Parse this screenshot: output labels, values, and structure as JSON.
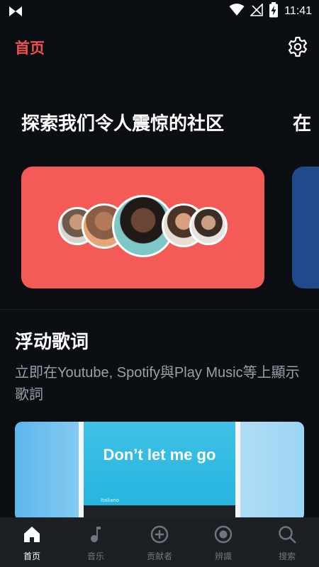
{
  "status_bar": {
    "time": "11:41",
    "icons": [
      "app-logo-icon",
      "wifi-icon",
      "no-signal-icon",
      "battery-charging-icon"
    ]
  },
  "header": {
    "title": "首页",
    "settings_icon": "gear-icon"
  },
  "carousel": {
    "cards": [
      {
        "title": "探索我们令人震惊的社区",
        "color": "#f45b57"
      },
      {
        "title": "在",
        "color": "#1f4a8c"
      }
    ]
  },
  "feature": {
    "title": "浮动歌词",
    "description": "立即在Youtube, Spotify與Play Music等上顯示歌詞",
    "preview": {
      "lyric": "Don’t let me go",
      "language": "Italiano"
    }
  },
  "bottom_nav": {
    "items": [
      {
        "label": "首页",
        "icon": "home-icon",
        "active": true
      },
      {
        "label": "音乐",
        "icon": "music-note-icon",
        "active": false
      },
      {
        "label": "贡献者",
        "icon": "plus-circle-icon",
        "active": false
      },
      {
        "label": "辨識",
        "icon": "record-icon",
        "active": false
      },
      {
        "label": "搜索",
        "icon": "search-icon",
        "active": false
      }
    ]
  },
  "colors": {
    "accent": "#f0504f",
    "background": "#0b0f13",
    "nav_background": "#1b2024"
  }
}
